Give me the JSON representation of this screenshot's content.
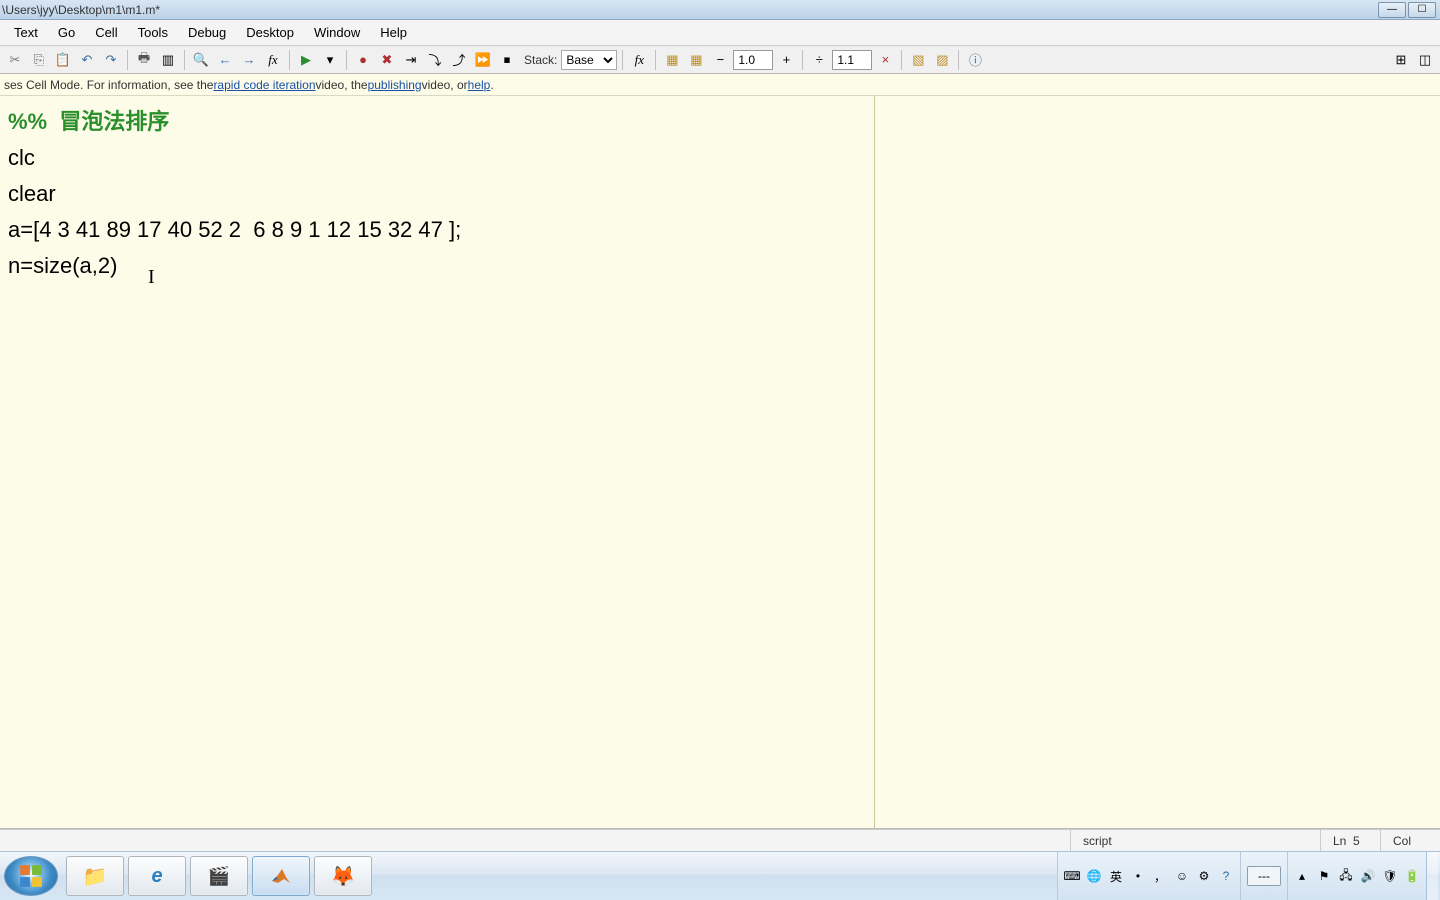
{
  "title": {
    "path": "\\Users\\jyy\\Desktop\\m1\\m1.m*"
  },
  "menu": {
    "items": [
      "Text",
      "Go",
      "Cell",
      "Tools",
      "Debug",
      "Desktop",
      "Window",
      "Help"
    ]
  },
  "toolbar": {
    "stack_label": "Stack:",
    "stack_value": "Base",
    "zoom_minus": "−",
    "zoom_value1": "1.0",
    "zoom_plus": "+",
    "div_label": "÷",
    "zoom_value2": "1.1",
    "x_label": "×"
  },
  "infobar": {
    "prefix": "ses Cell Mode. For information, see the ",
    "link1": "rapid code iteration",
    "mid1": " video, the ",
    "link2": "publishing",
    "mid2": " video, or ",
    "link3": "help",
    "suffix": "."
  },
  "code": {
    "section_marker": "%%",
    "section_title": "  冒泡法排序",
    "line2": "clc",
    "line3": "clear",
    "line4": "a=[4 3 41 89 17 40 52 2  6 8 9 1 12 15 32 47 ];",
    "line5": "n=size(a,2)"
  },
  "status": {
    "filetype": "script",
    "ln_label": "Ln",
    "ln_value": "5",
    "col_label": "Col"
  },
  "taskbar": {
    "lang": "---",
    "ime_text": "英"
  }
}
